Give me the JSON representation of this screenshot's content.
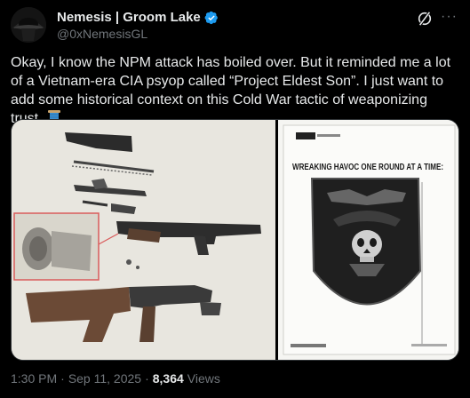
{
  "author": {
    "display_name": "Nemesis | Groom Lake",
    "handle": "@0xNemesisGL",
    "verified": true
  },
  "tweet": {
    "text": "Okay, I know the NPM attack has boiled over. But it reminded me a lot of a Vietnam-era CIA psyop called “Project Eldest Son”. I just want to add some historical context on this Cold War tactic of weaponizing trust.",
    "emoji": "spool-of-thread"
  },
  "media": {
    "left_image": "disassembled rifle photo with inset of bullet rounds",
    "right_image": {
      "headline": "WREAKING HAVOC ONE ROUND AT A TIME:"
    }
  },
  "meta": {
    "time": "1:30 PM",
    "date": "Sep 11, 2025",
    "views_count": "8,364",
    "views_label": "Views",
    "separator": "·"
  },
  "icons": {
    "verified": "verified-badge-icon",
    "grok": "grok-icon",
    "more": "more-icon"
  },
  "colors": {
    "background": "#000000",
    "text": "#e7e9ea",
    "secondary": "#71767b",
    "verified": "#1d9bf0"
  }
}
